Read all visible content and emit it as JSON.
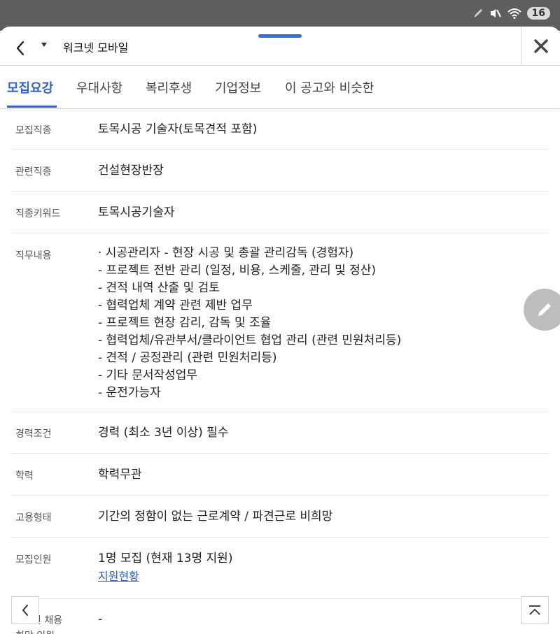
{
  "status_bar": {
    "battery": "16"
  },
  "app_bar": {
    "title": "워크넷 모바일"
  },
  "tabs": [
    {
      "label": "모집요강",
      "active": true
    },
    {
      "label": "우대사항"
    },
    {
      "label": "복리후생"
    },
    {
      "label": "기업정보"
    },
    {
      "label": "이 공고와 비슷한"
    }
  ],
  "rows": [
    {
      "label": "모집직종",
      "lines": [
        "토목시공 기술자(토목견적 포함)"
      ]
    },
    {
      "label": "관련직종",
      "lines": [
        "건설현장반장"
      ]
    },
    {
      "label": "직종키워드",
      "lines": [
        "토목시공기술자"
      ]
    },
    {
      "label": "직무내용",
      "lines": [
        " · 시공관리자 - 현장 시공 및 총괄 관리감독 (경험자)",
        "- 프로젝트 전반 관리 (일정, 비용, 스케줄, 관리 및 정산)",
        "- 견적 내역 산출 및 검토",
        "- 협력업체 계약 관련 제반 업무",
        "- 프로젝트 현장 감리, 감독 및 조율",
        "- 협력업체/유관부서/클라이언트 협업 관리 (관련 민원처리등)",
        "- 견적 / 공정관리 (관련 민원처리등)",
        "- 기타 문서작성업무",
        "- 운전가능자"
      ]
    },
    {
      "label": "경력조건",
      "lines": [
        "경력 (최소 3년 이상) 필수"
      ]
    },
    {
      "label": "학력",
      "lines": [
        "학력무관"
      ]
    },
    {
      "label": "고용형태",
      "lines": [
        "기간의 정함이 없는 근로계약 / 파견근로 비희망"
      ]
    },
    {
      "label": "모집인원",
      "lines": [
        "1명 모집 (현재 13명 지원)"
      ],
      "link": "지원현황"
    },
    {
      "label": "인 채용",
      "label2": "희망 인원",
      "lines": [
        "-"
      ]
    }
  ],
  "icons": {
    "back": "chevron-left-icon",
    "close": "close-icon",
    "edit": "pencil-icon",
    "scroll_top": "arrow-up-to-top-icon"
  },
  "colors": {
    "accent": "#2f5fd0",
    "link": "#2a5cc8",
    "status_bar": "#5e5e60",
    "fab": "#bdbdbd"
  }
}
